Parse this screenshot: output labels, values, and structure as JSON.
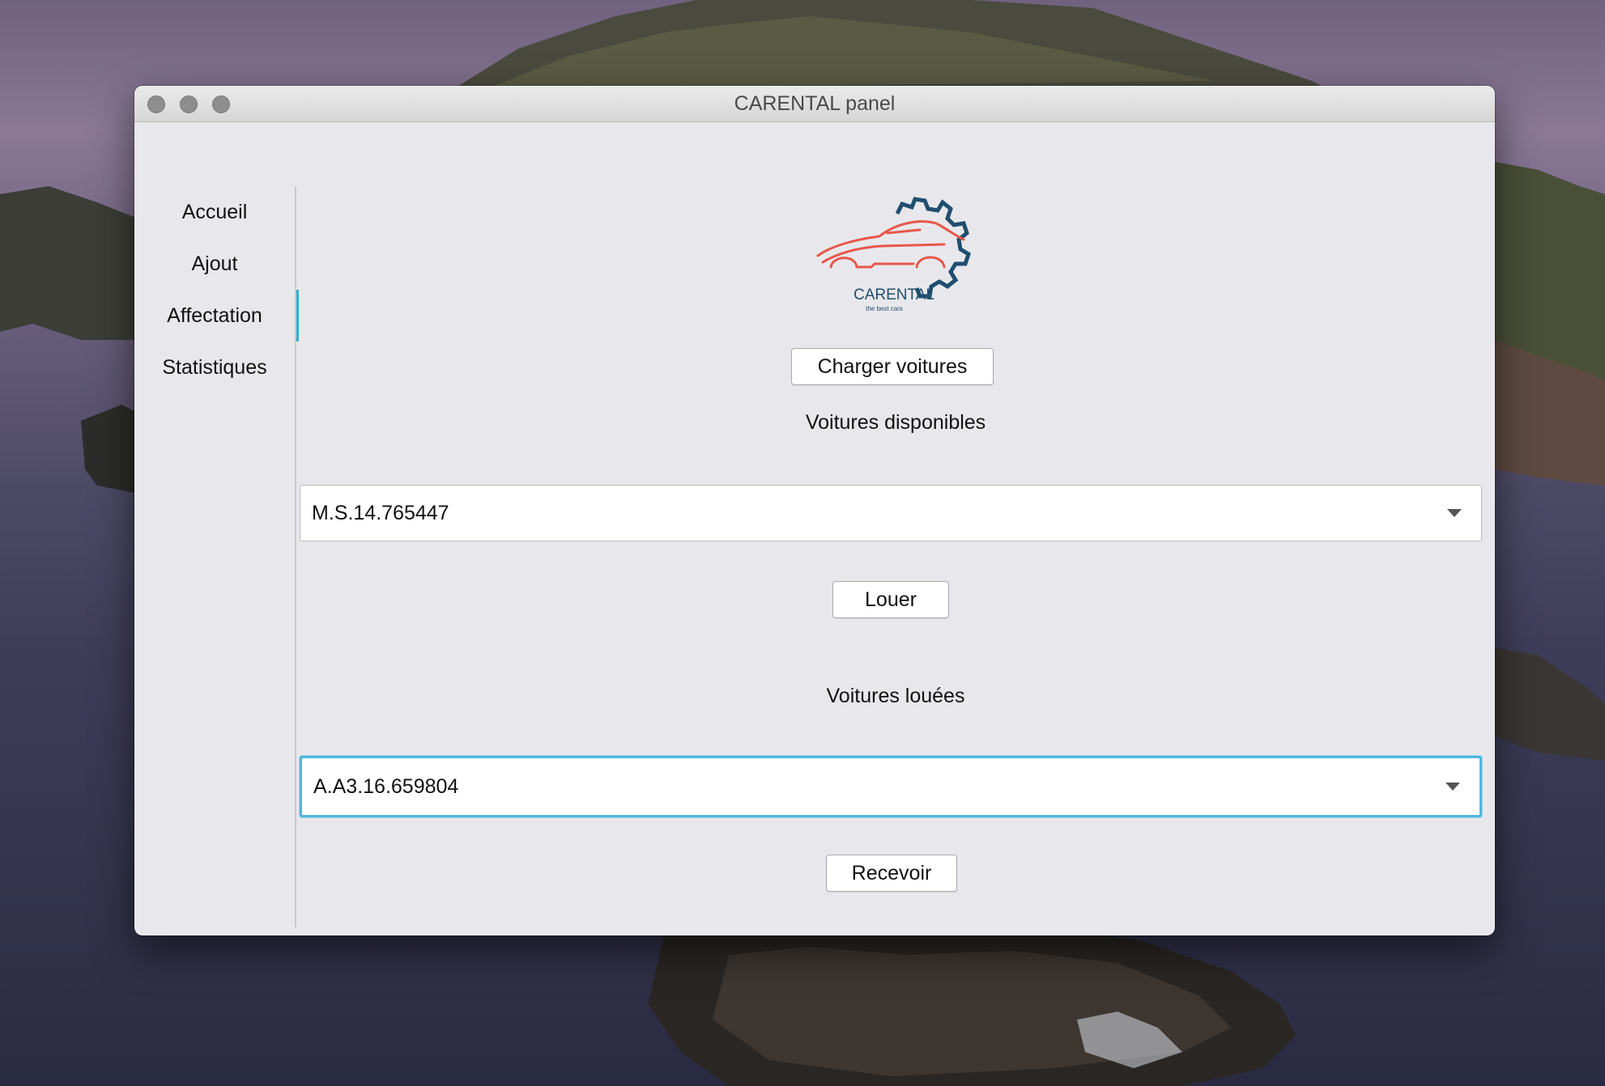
{
  "window": {
    "title": "CARENTAL panel"
  },
  "sidebar": {
    "items": [
      {
        "label": "Accueil"
      },
      {
        "label": "Ajout"
      },
      {
        "label": "Affectation",
        "active": true
      },
      {
        "label": "Statistiques"
      }
    ],
    "active_color": "#2ab3d6"
  },
  "logo": {
    "name": "CARENTAL",
    "tagline": "the best cars",
    "icon": "car-gear-logo",
    "car_color": "#e8574a",
    "gear_color": "#1f4e6e"
  },
  "main": {
    "load_button": "Charger voitures",
    "available_label": "Voitures disponibles",
    "available_selected": "M.S.14.765447",
    "rent_button": "Louer",
    "rented_label": "Voitures louées",
    "rented_selected": "A.A3.16.659804",
    "receive_button": "Recevoir"
  },
  "colors": {
    "focus_ring": "#4fb7dc"
  }
}
